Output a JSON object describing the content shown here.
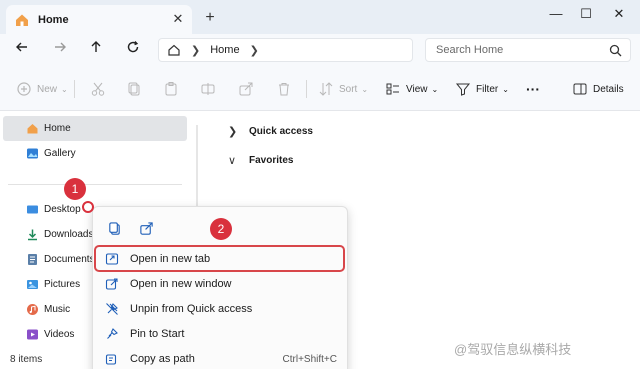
{
  "titlebar": {
    "tab_title": "Home",
    "new_tab_label": "+",
    "close_tab_label": "✕",
    "minimize_label": "—",
    "maximize_label": "☐",
    "close_window_label": "✕"
  },
  "address": {
    "location": "Home",
    "search_placeholder": "Search Home"
  },
  "toolbar": {
    "new_label": "New",
    "sort_label": "Sort",
    "view_label": "View",
    "filter_label": "Filter",
    "more_label": "···",
    "details_label": "Details"
  },
  "sidebar": {
    "items": [
      {
        "label": "Home",
        "icon": "home-icon"
      },
      {
        "label": "Gallery",
        "icon": "gallery-icon"
      },
      {
        "label": "Desktop",
        "icon": "desktop-icon"
      },
      {
        "label": "Downloads",
        "icon": "downloads-icon"
      },
      {
        "label": "Documents",
        "icon": "documents-icon"
      },
      {
        "label": "Pictures",
        "icon": "pictures-icon"
      },
      {
        "label": "Music",
        "icon": "music-icon"
      },
      {
        "label": "Videos",
        "icon": "videos-icon"
      }
    ]
  },
  "main": {
    "sections": [
      {
        "label": "Quick access",
        "state": "collapsed"
      },
      {
        "label": "Favorites",
        "state": "expanded"
      }
    ]
  },
  "context_menu": {
    "items": [
      {
        "label": "Open in new tab",
        "icon": "open-new-tab-icon",
        "shortcut": ""
      },
      {
        "label": "Open in new window",
        "icon": "open-new-window-icon",
        "shortcut": ""
      },
      {
        "label": "Unpin from Quick access",
        "icon": "unpin-icon",
        "shortcut": ""
      },
      {
        "label": "Pin to Start",
        "icon": "pin-icon",
        "shortcut": ""
      },
      {
        "label": "Copy as path",
        "icon": "copy-path-icon",
        "shortcut": "Ctrl+Shift+C"
      }
    ],
    "top_icons": [
      "copy-icon",
      "share-icon"
    ]
  },
  "annotations": {
    "marker_1": "1",
    "marker_2": "2"
  },
  "status": {
    "item_count": "8 items"
  },
  "watermark": "@驾驭信息纵横科技",
  "colors": {
    "accent_red": "#d9313d",
    "titlebar_bg": "#e8eef5",
    "selected_bg": "#e2e4e7"
  }
}
